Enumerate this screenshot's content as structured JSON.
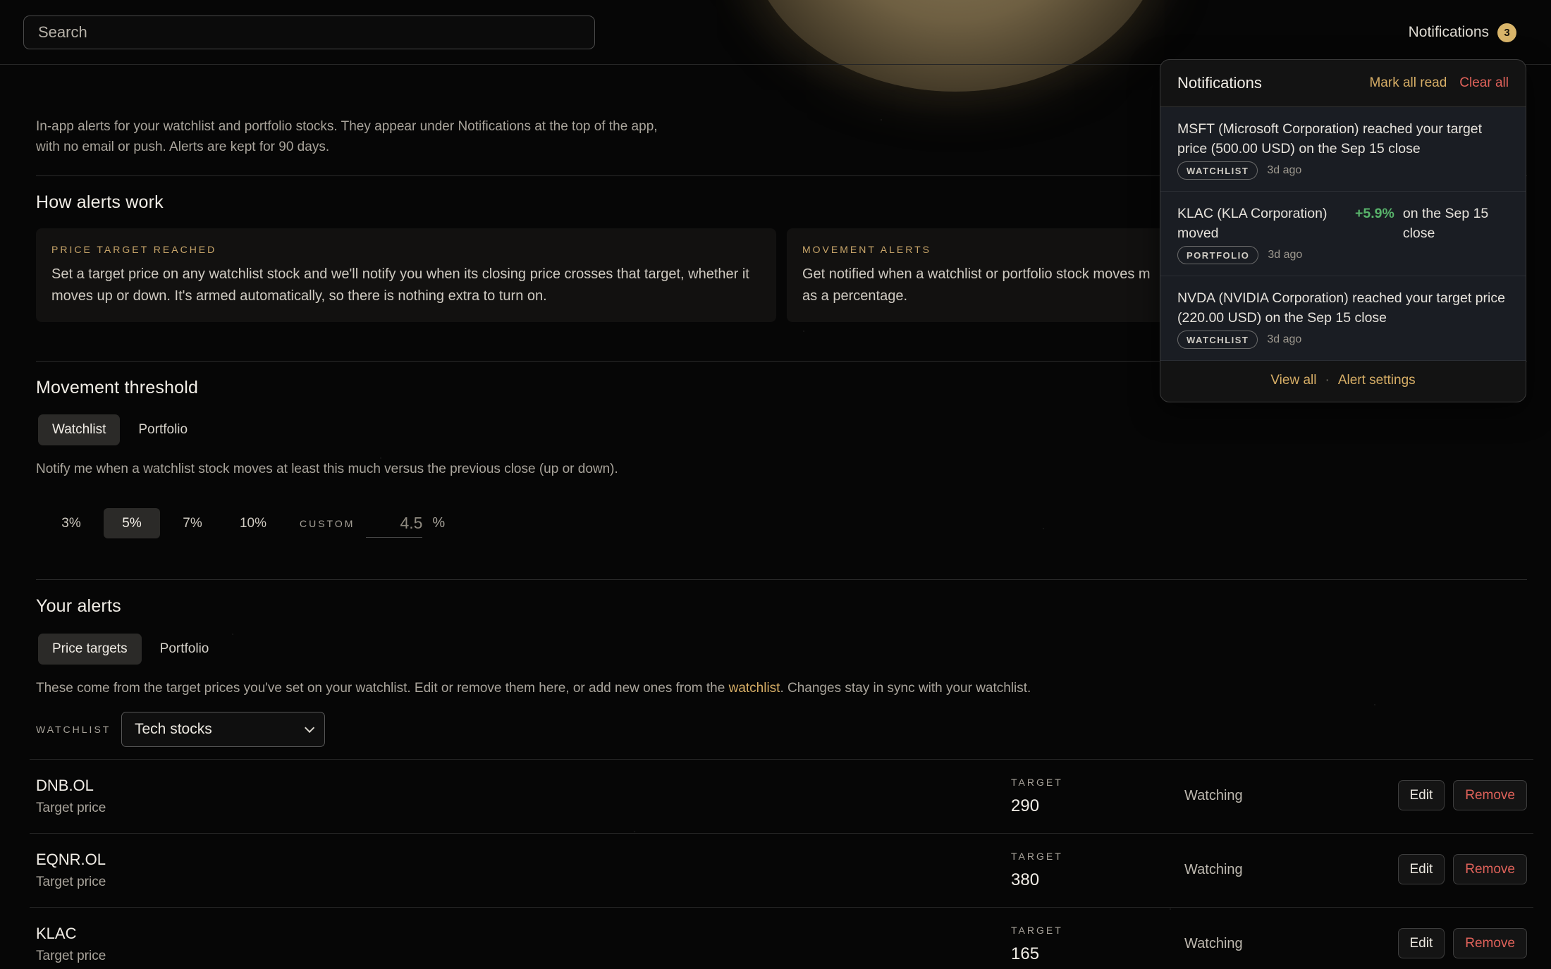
{
  "search": {
    "placeholder": "Search"
  },
  "notifications_trigger": {
    "label": "Notifications",
    "count": "3"
  },
  "intro": "In-app alerts for your watchlist and portfolio stocks. They appear under Notifications at the top of the app, with no email or push. Alerts are kept for 90 days.",
  "how": {
    "title": "How alerts work",
    "cards": [
      {
        "eyebrow": "PRICE TARGET REACHED",
        "body": "Set a target price on any watchlist stock and we'll notify you when its closing price crosses that target, whether it moves up or down. It's armed automatically, so there is nothing extra to turn on."
      },
      {
        "eyebrow": "MOVEMENT ALERTS",
        "body": "Get notified when a watchlist or portfolio stock moves m as a percentage."
      }
    ]
  },
  "threshold": {
    "title": "Movement threshold",
    "tabs": [
      "Watchlist",
      "Portfolio"
    ],
    "note": "Notify me when a watchlist stock moves at least this much versus the previous close (up or down).",
    "options": [
      "3%",
      "5%",
      "7%",
      "10%"
    ],
    "selected": "5%",
    "custom_label": "CUSTOM",
    "custom_placeholder": "4.5",
    "custom_unit": "%"
  },
  "alerts": {
    "title": "Your alerts",
    "tabs": [
      "Price targets",
      "Portfolio"
    ],
    "note_before": "These come from the target prices you've set on your watchlist. Edit or remove them here, or add new ones from the ",
    "note_link": "watchlist",
    "note_after": ". Changes stay in sync with your watchlist.",
    "watchlist_label": "WATCHLIST",
    "watchlist_selected": "Tech stocks",
    "target_label": "TARGET",
    "edit_label": "Edit",
    "remove_label": "Remove",
    "rows": [
      {
        "symbol": "DNB.OL",
        "sub": "Target price",
        "target": "290",
        "status": "Watching"
      },
      {
        "symbol": "EQNR.OL",
        "sub": "Target price",
        "target": "380",
        "status": "Watching"
      },
      {
        "symbol": "KLAC",
        "sub": "Target price",
        "target": "165",
        "status": "Watching"
      }
    ]
  },
  "panel": {
    "title": "Notifications",
    "mark_read": "Mark all read",
    "clear_all": "Clear all",
    "items": [
      {
        "text": "MSFT (Microsoft Corporation) reached your target price (500.00 USD) on the Sep 15 close",
        "tag": "WATCHLIST",
        "ago": "3d ago"
      },
      {
        "text_a": "KLAC (KLA Corporation) moved",
        "change": "+5.9%",
        "text_b": "on the Sep 15 close",
        "tag": "PORTFOLIO",
        "ago": "3d ago"
      },
      {
        "text": "NVDA (NVIDIA Corporation) reached your target price (220.00 USD) on the Sep 15 close",
        "tag": "WATCHLIST",
        "ago": "3d ago"
      }
    ],
    "view_all": "View all",
    "separator": "·",
    "alert_settings": "Alert settings"
  },
  "colors": {
    "accent": "#d7ae66",
    "danger": "#e0625a",
    "positive": "#58b36b"
  }
}
